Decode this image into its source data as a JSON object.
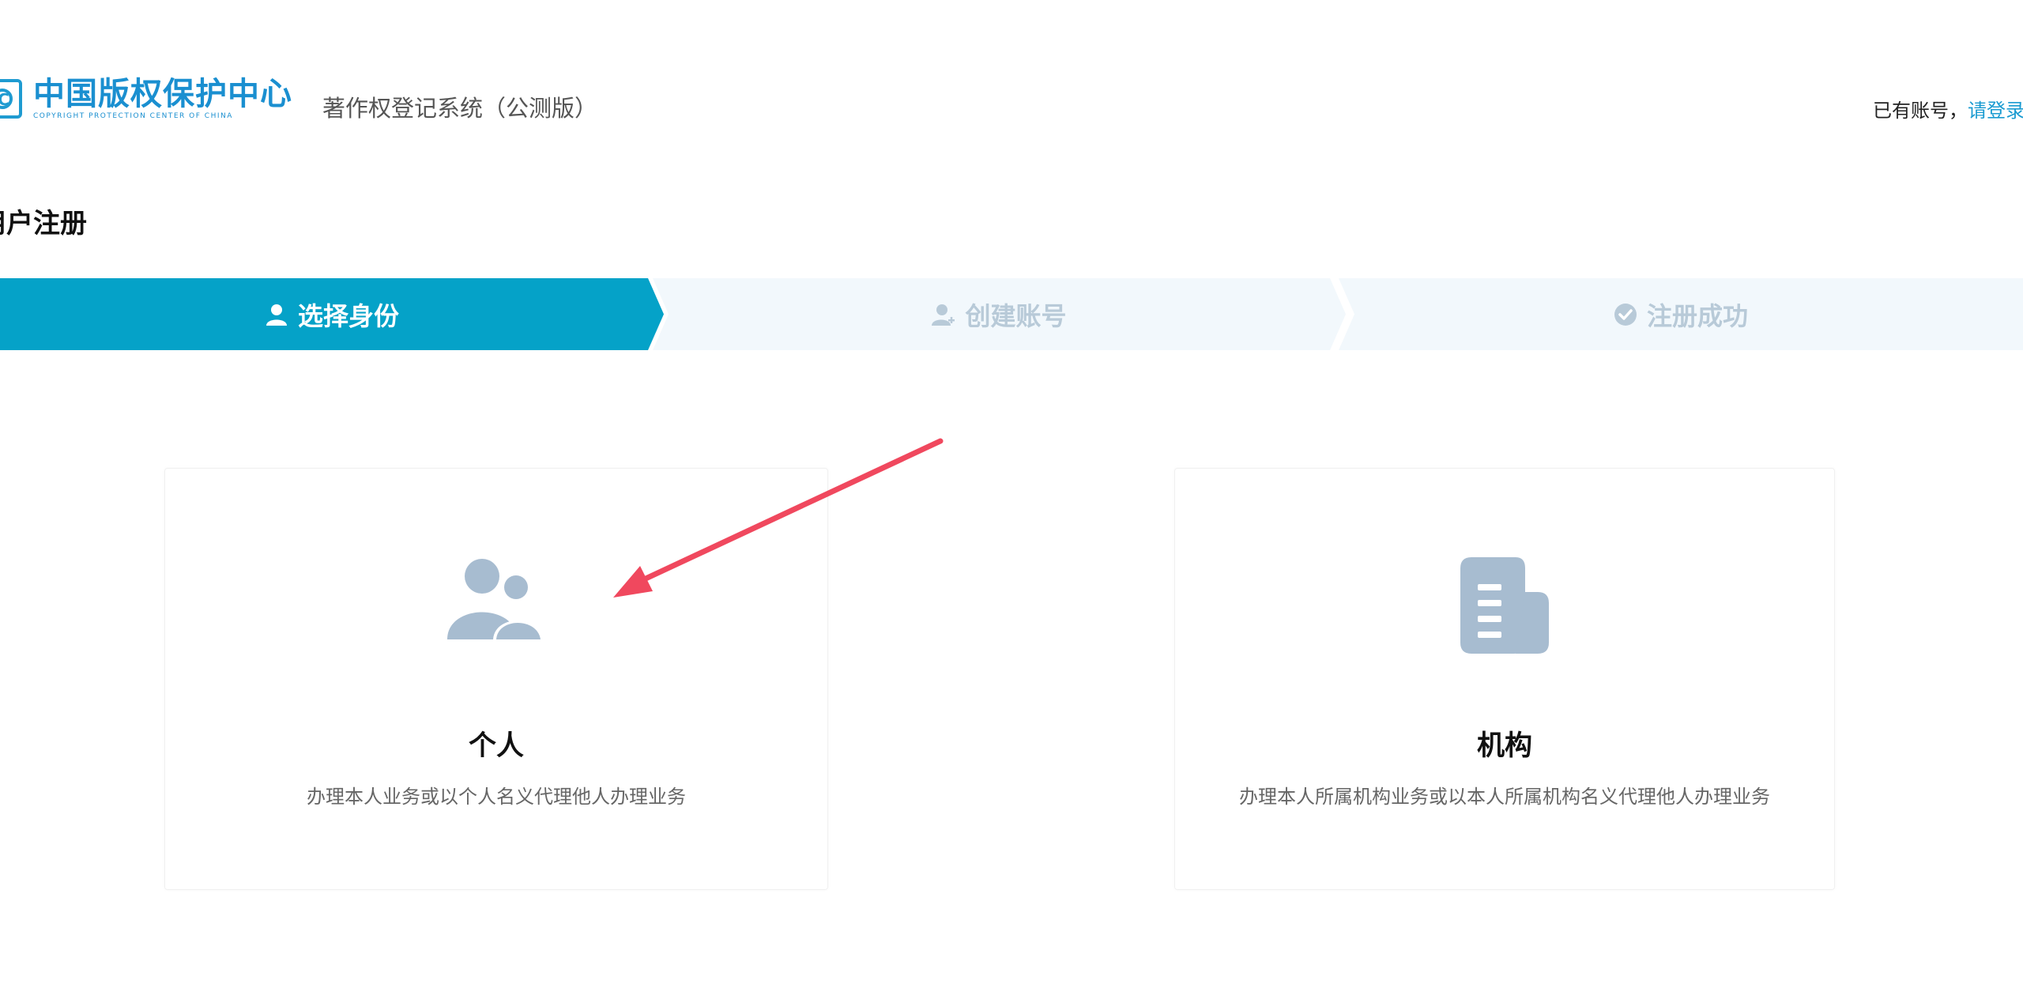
{
  "header": {
    "logo_cn": "中国版权保护中心",
    "logo_en": "COPYRIGHT PROTECTION CENTER OF CHINA",
    "logo_mark": "C",
    "system_title": "著作权登记系统（公测版）",
    "login_prefix": "已有账号，",
    "login_link": "请登录"
  },
  "page_title": "用户注册",
  "steps": [
    {
      "label": "选择身份",
      "icon": "user-icon",
      "active": true
    },
    {
      "label": "创建账号",
      "icon": "user-add-icon",
      "active": false
    },
    {
      "label": "注册成功",
      "icon": "check-circle-icon",
      "active": false
    }
  ],
  "cards": {
    "personal": {
      "title": "个人",
      "description": "办理本人业务或以个人名义代理他人办理业务",
      "icon": "people-icon"
    },
    "organization": {
      "title": "机构",
      "description": "办理本人所属机构业务或以本人所属机构名义代理他人办理业务",
      "icon": "document-icon"
    }
  },
  "colors": {
    "primary": "#05a2c8",
    "step_inactive_bg": "#f2f8fc",
    "step_inactive_text": "#b8cad8",
    "icon_gray": "#a7bcd0",
    "link": "#1a9bd1",
    "annotation_arrow": "#f0485e"
  }
}
